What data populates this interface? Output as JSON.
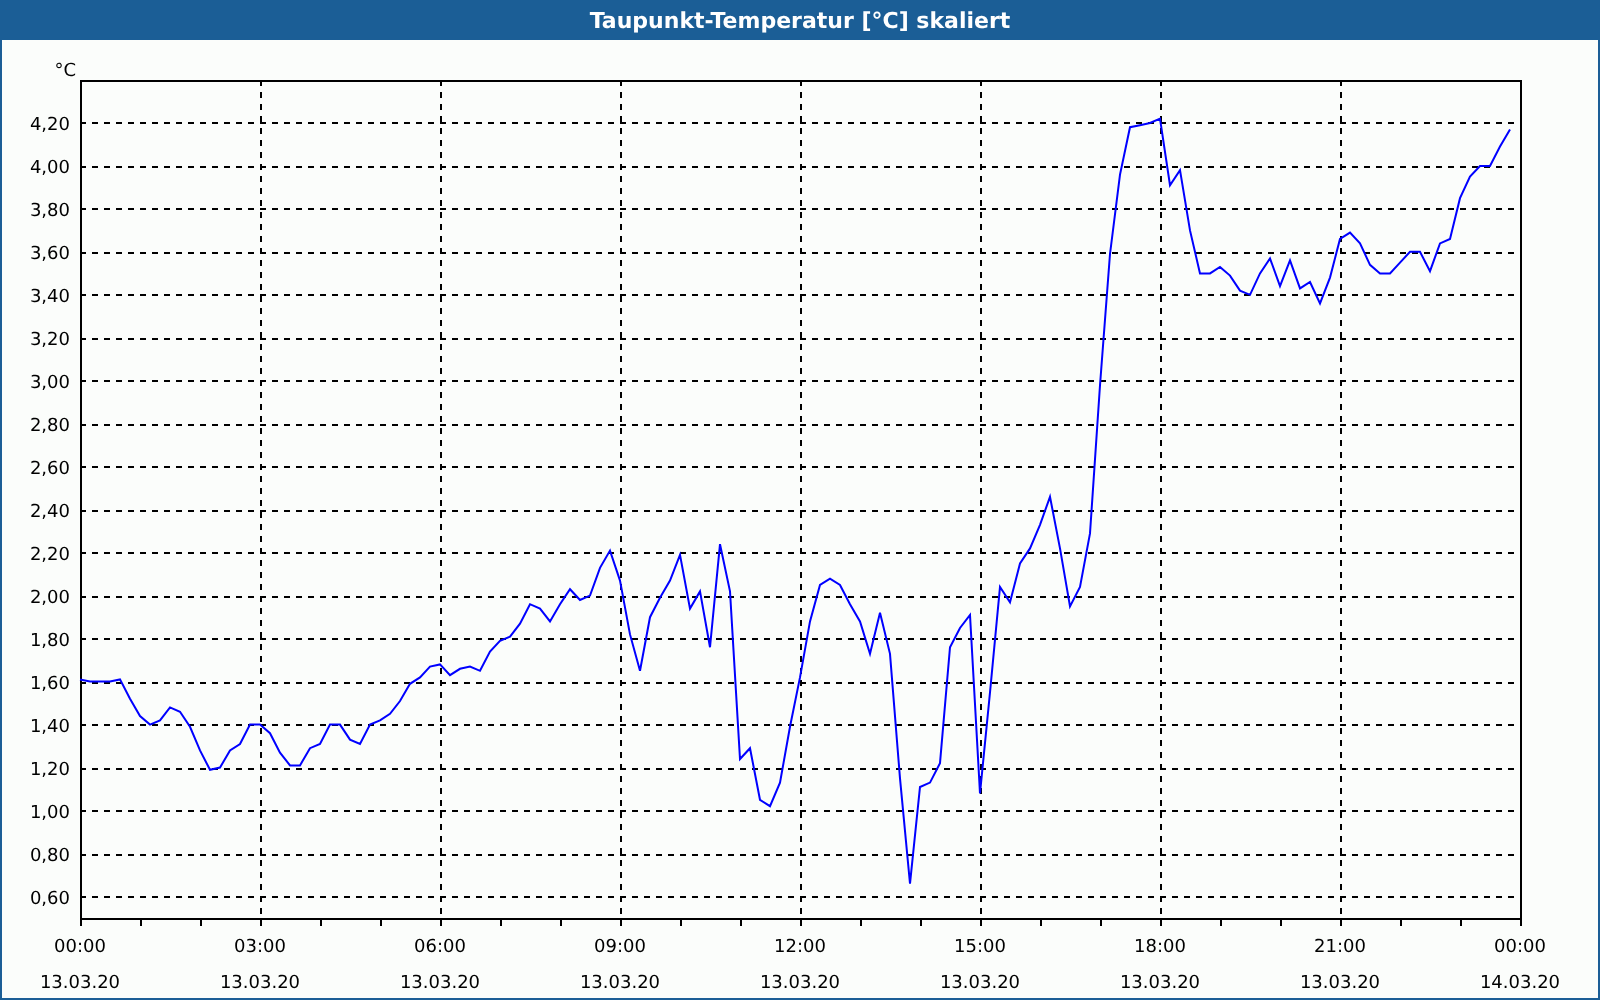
{
  "window": {
    "title": "Taupunkt-Temperatur [°C] skaliert"
  },
  "chart": {
    "chart_data": {
      "type": "line",
      "grid": true,
      "ylabel": "°C",
      "ylim": [
        0.5,
        4.4
      ],
      "yticks": [
        {
          "value": 0.6,
          "label": "0,60"
        },
        {
          "value": 0.8,
          "label": "0,80"
        },
        {
          "value": 1.0,
          "label": "1,00"
        },
        {
          "value": 1.2,
          "label": "1,20"
        },
        {
          "value": 1.4,
          "label": "1,40"
        },
        {
          "value": 1.6,
          "label": "1,60"
        },
        {
          "value": 1.8,
          "label": "1,80"
        },
        {
          "value": 2.0,
          "label": "2,00"
        },
        {
          "value": 2.2,
          "label": "2,20"
        },
        {
          "value": 2.4,
          "label": "2,40"
        },
        {
          "value": 2.6,
          "label": "2,60"
        },
        {
          "value": 2.8,
          "label": "2,80"
        },
        {
          "value": 3.0,
          "label": "3,00"
        },
        {
          "value": 3.2,
          "label": "3,20"
        },
        {
          "value": 3.4,
          "label": "3,40"
        },
        {
          "value": 3.6,
          "label": "3,60"
        },
        {
          "value": 3.8,
          "label": "3,80"
        },
        {
          "value": 4.0,
          "label": "4,00"
        },
        {
          "value": 4.2,
          "label": "4,20"
        }
      ],
      "categories": [
        "00:00\n13.03.20",
        null,
        null,
        null,
        null,
        null,
        null,
        null,
        null,
        null,
        null,
        null,
        null,
        null,
        null,
        null,
        null,
        null,
        "03:00\n13.03.20",
        null,
        null,
        null,
        null,
        null,
        null,
        null,
        null,
        null,
        null,
        null,
        null,
        null,
        null,
        null,
        null,
        null,
        "06:00\n13.03.20",
        null,
        null,
        null,
        null,
        null,
        null,
        null,
        null,
        null,
        null,
        null,
        null,
        null,
        null,
        null,
        null,
        null,
        "09:00\n13.03.20",
        null,
        null,
        null,
        null,
        null,
        null,
        null,
        null,
        null,
        null,
        null,
        null,
        null,
        null,
        null,
        null,
        null,
        "12:00\n13.03.20",
        null,
        null,
        null,
        null,
        null,
        null,
        null,
        null,
        null,
        null,
        null,
        null,
        null,
        null,
        null,
        null,
        null,
        "15:00\n13.03.20",
        null,
        null,
        null,
        null,
        null,
        null,
        null,
        null,
        null,
        null,
        null,
        null,
        null,
        null,
        null,
        null,
        null,
        "18:00\n13.03.20",
        null,
        null,
        null,
        null,
        null,
        null,
        null,
        null,
        null,
        null,
        null,
        null,
        null,
        null,
        null,
        null,
        null,
        "21:00\n13.03.20",
        null,
        null,
        null,
        null,
        null,
        null,
        null,
        null,
        null,
        null,
        null,
        null,
        null,
        null,
        null,
        null,
        null,
        "00:00\n14.03.20"
      ],
      "series": [
        {
          "color": "#0000ff",
          "values": [
            1.61,
            1.6,
            1.6,
            1.6,
            1.61,
            1.52,
            1.44,
            1.4,
            1.42,
            1.48,
            1.46,
            1.39,
            1.28,
            1.19,
            1.2,
            1.28,
            1.31,
            1.4,
            1.4,
            1.36,
            1.27,
            1.21,
            1.21,
            1.29,
            1.31,
            1.4,
            1.4,
            1.33,
            1.31,
            1.4,
            1.42,
            1.45,
            1.51,
            1.59,
            1.62,
            1.67,
            1.68,
            1.63,
            1.66,
            1.67,
            1.65,
            1.74,
            1.79,
            1.81,
            1.87,
            1.96,
            1.94,
            1.88,
            1.96,
            2.03,
            1.98,
            2.0,
            2.13,
            2.21,
            2.07,
            1.82,
            1.65,
            1.9,
            1.99,
            2.07,
            2.19,
            1.94,
            2.02,
            1.76,
            2.24,
            2.02,
            1.24,
            1.29,
            1.05,
            1.02,
            1.13,
            1.39,
            1.62,
            1.88,
            2.05,
            2.08,
            2.05,
            1.96,
            1.88,
            1.73,
            1.92,
            1.73,
            1.15,
            0.66,
            1.11,
            1.13,
            1.22,
            1.76,
            1.85,
            1.91,
            1.08,
            1.55,
            2.04,
            1.97,
            2.15,
            2.22,
            2.33,
            2.46,
            2.22,
            1.95,
            2.04,
            2.29,
            2.98,
            3.59,
            3.96,
            4.18,
            4.19,
            4.2,
            4.22,
            3.91,
            3.98,
            3.7,
            3.5,
            3.5,
            3.53,
            3.49,
            3.42,
            3.4,
            3.5,
            3.57,
            3.44,
            3.56,
            3.43,
            3.46,
            3.36,
            3.48,
            3.66,
            3.69,
            3.64,
            3.54,
            3.5,
            3.5,
            3.55,
            3.6,
            3.6,
            3.51,
            3.64,
            3.66,
            3.85,
            3.95,
            4.0,
            4.0,
            4.09,
            4.17,
            null
          ]
        }
      ]
    }
  }
}
